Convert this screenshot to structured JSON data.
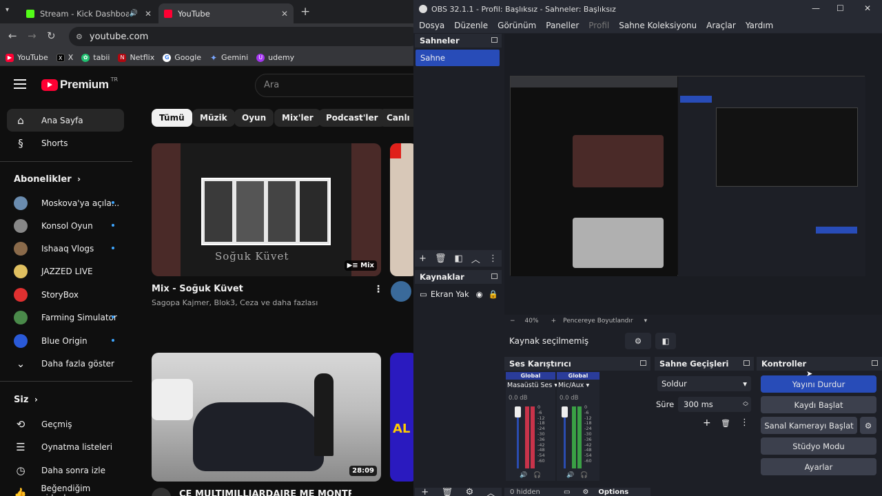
{
  "chrome": {
    "tabs": [
      {
        "title": "Stream - Kick Dashboard",
        "fav_color": "#53fc18"
      },
      {
        "title": "YouTube",
        "fav_color": "#ff0033"
      }
    ],
    "url": "youtube.com",
    "bookmarks": [
      "YouTube",
      "X",
      "tabii",
      "Netflix",
      "Google",
      "Gemini",
      "udemy"
    ]
  },
  "youtube": {
    "logo": "Premium",
    "region": "TR",
    "search_placeholder": "Ara",
    "nav": [
      {
        "label": "Ana Sayfa",
        "icon": "home-icon"
      },
      {
        "label": "Shorts",
        "icon": "shorts-icon"
      }
    ],
    "subs_title": "Abonelikler",
    "subs": [
      {
        "name": "Moskova'ya açıla...",
        "color": "#6a8caf"
      },
      {
        "name": "Konsol Oyun",
        "color": "#888888"
      },
      {
        "name": "Ishaaq Vlogs",
        "color": "#8a6a4a"
      },
      {
        "name": "JAZZED LIVE",
        "color": "#e0c060"
      },
      {
        "name": "StoryBox",
        "color": "#e03030"
      },
      {
        "name": "Farming Simulator",
        "color": "#4a8a4a"
      },
      {
        "name": "Blue Origin",
        "color": "#2a5ad8"
      }
    ],
    "show_more": "Daha fazla göster",
    "you_title": "Siz",
    "you_items": [
      "Geçmiş",
      "Oynatma listeleri",
      "Daha sonra izle",
      "Beğendiğim videolar"
    ],
    "chips": [
      "Tümü",
      "Müzik",
      "Oyun",
      "Mix'ler",
      "Podcast'ler",
      "Canlı"
    ],
    "videos": [
      {
        "title": "Mix - Soğuk Küvet",
        "meta": "Sagopa Kajmer, Blok3, Ceza ve daha fazlası",
        "badge": "Mix",
        "thumb_text": "Soğuk Küvet"
      },
      {
        "title": "CE MULTIMILLIARDAIRE ME MONTRE SA",
        "badge": "28:09"
      }
    ]
  },
  "obs": {
    "title": "OBS 32.1.1 - Profil: Başlıksız - Sahneler: Başlıksız",
    "menu": [
      "Dosya",
      "Düzenle",
      "Görünüm",
      "Paneller",
      "Profil",
      "Sahne Koleksiyonu",
      "Araçlar",
      "Yardım"
    ],
    "scenes_title": "Sahneler",
    "scene": "Sahne",
    "sources_title": "Kaynaklar",
    "source": "Ekran Yak",
    "zoom": "40%",
    "fit": "Pencereye Boyutlandır",
    "no_source": "Kaynak seçilmemiş",
    "mixer_title": "Ses Karıştırıcı",
    "channels": [
      {
        "tag": "Global",
        "name": "Masaüstü Ses",
        "db": "0.0 dB",
        "bar": "#c8334a"
      },
      {
        "tag": "Global",
        "name": "Mic/Aux",
        "db": "0.0 dB",
        "bar": "#3aa045"
      }
    ],
    "scale": [
      "0",
      "-6",
      "-12",
      "-18",
      "-24",
      "-30",
      "-36",
      "-42",
      "-48",
      "-54",
      "-60"
    ],
    "hidden": "0 hidden",
    "options": "Options",
    "transitions_title": "Sahne Geçişleri",
    "transition": "Soldur",
    "duration_label": "Süre",
    "duration": "300 ms",
    "controls_title": "Kontroller",
    "controls": [
      "Yayını Durdur",
      "Kaydı Başlat",
      "Sanal Kamerayı Başlat",
      "Stüdyo Modu",
      "Ayarlar"
    ]
  }
}
